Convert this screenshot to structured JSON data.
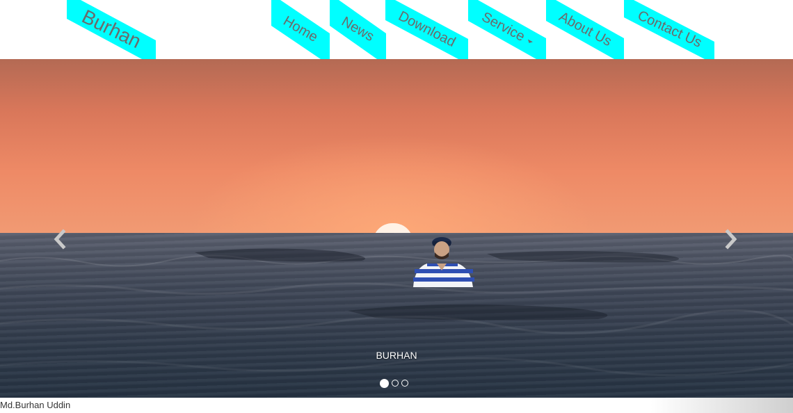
{
  "brand": {
    "label": "Burhan"
  },
  "nav": {
    "items": [
      {
        "label": "Home"
      },
      {
        "label": "News"
      },
      {
        "label": "Download"
      },
      {
        "label": "Service"
      },
      {
        "label": "About Us"
      },
      {
        "label": "Contact Us"
      }
    ]
  },
  "carousel": {
    "caption": "BURHAN",
    "slide_count": 3,
    "active_slide": 1,
    "prev_icon": "chevron-left-icon",
    "next_icon": "chevron-right-icon"
  },
  "footer": {
    "text": "Md.Burhan Uddin"
  },
  "colors": {
    "tab_fill": "#00ffff",
    "tab_text": "#6b6b6b",
    "caption_text": "#ffffff"
  }
}
